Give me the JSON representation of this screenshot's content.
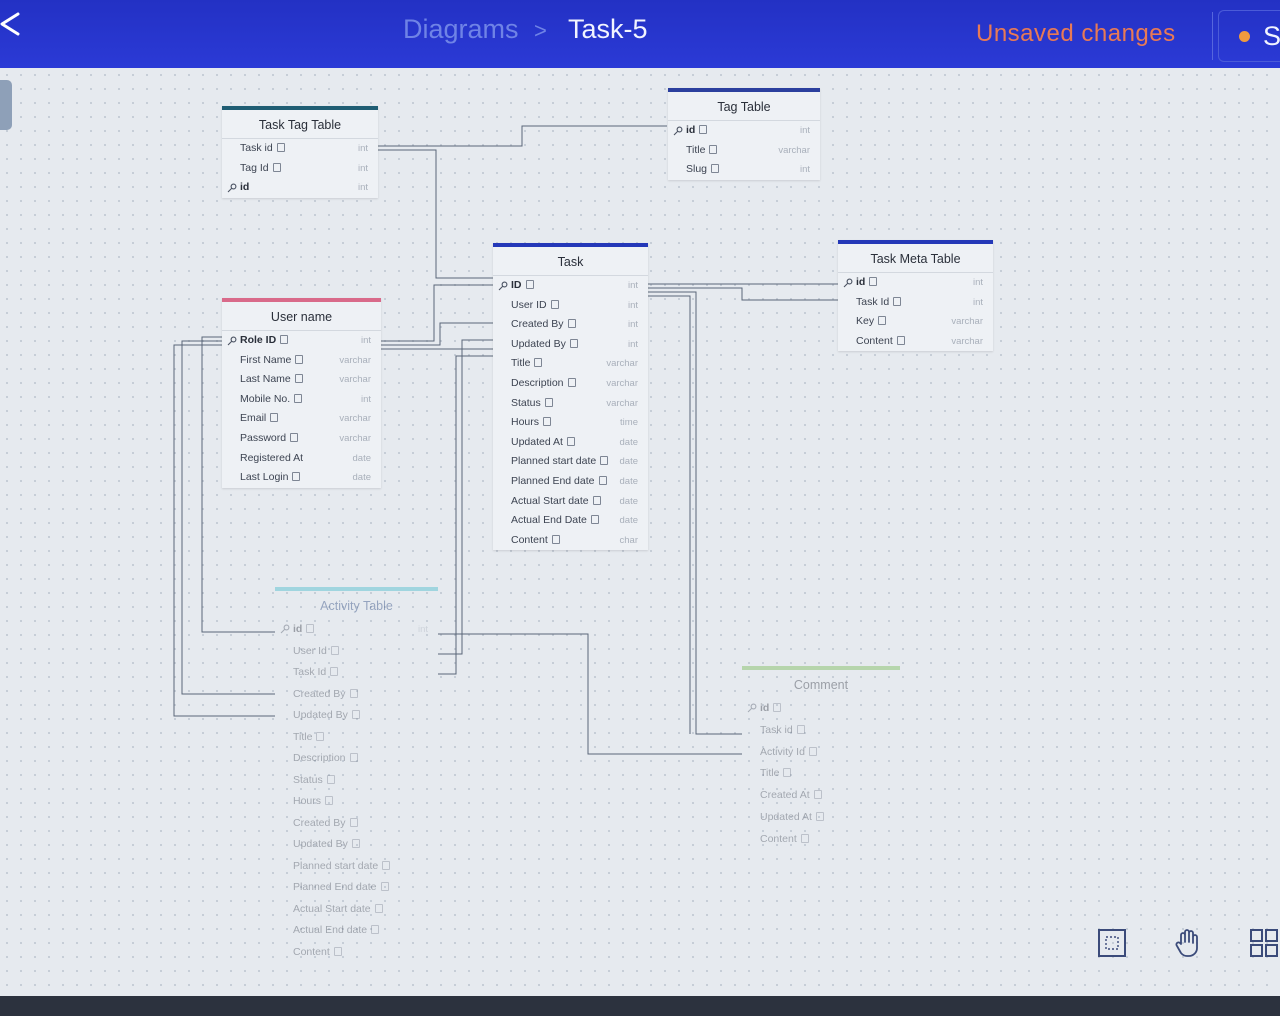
{
  "header": {
    "breadcrumb_root": "Diagrams",
    "breadcrumb_separator": ">",
    "breadcrumb_current": "Task-5",
    "status": "Unsaved changes",
    "save_label_partial": "S"
  },
  "colors": {
    "header_bg": "#2b3ad6",
    "status_text": "#e87a55",
    "accent_dot": "#f09a3e"
  },
  "tables": {
    "task_tag": {
      "title": "Task Tag Table",
      "bar_color": "#1f5d73",
      "rows": [
        {
          "name": "Task id",
          "type": "int"
        },
        {
          "name": "Tag Id",
          "type": "int"
        },
        {
          "name": "id",
          "type": "int"
        }
      ]
    },
    "tag": {
      "title": "Tag Table",
      "bar_color": "#2b3f9e",
      "rows": [
        {
          "name": "id",
          "type": "int"
        },
        {
          "name": "Title",
          "type": "varchar"
        },
        {
          "name": "Slug",
          "type": "int"
        }
      ]
    },
    "task": {
      "title": "Task",
      "bar_color": "#2438b8",
      "rows": [
        {
          "name": "ID",
          "type": "int"
        },
        {
          "name": "User ID",
          "type": "int"
        },
        {
          "name": "Created By",
          "type": "int"
        },
        {
          "name": "Updated By",
          "type": "int"
        },
        {
          "name": "Title",
          "type": "varchar"
        },
        {
          "name": "Description",
          "type": "varchar"
        },
        {
          "name": "Status",
          "type": "varchar"
        },
        {
          "name": "Hours",
          "type": "time"
        },
        {
          "name": "Updated At",
          "type": "date"
        },
        {
          "name": "Planned start date",
          "type": "date"
        },
        {
          "name": "Planned End date",
          "type": "date"
        },
        {
          "name": "Actual Start date",
          "type": "date"
        },
        {
          "name": "Actual End Date",
          "type": "date"
        },
        {
          "name": "Content",
          "type": "char"
        }
      ]
    },
    "task_meta": {
      "title": "Task Meta Table",
      "bar_color": "#2438b8",
      "rows": [
        {
          "name": "id",
          "type": "int"
        },
        {
          "name": "Task Id",
          "type": "int"
        },
        {
          "name": "Key",
          "type": "varchar"
        },
        {
          "name": "Content",
          "type": "varchar"
        }
      ]
    },
    "user": {
      "title": "User name",
      "bar_color": "#d96a8a",
      "rows": [
        {
          "name": "Role ID",
          "type": "int"
        },
        {
          "name": "First Name",
          "type": "varchar"
        },
        {
          "name": "Last Name",
          "type": "varchar"
        },
        {
          "name": "Mobile No.",
          "type": "int"
        },
        {
          "name": "Email",
          "type": "varchar"
        },
        {
          "name": "Password",
          "type": "varchar"
        },
        {
          "name": "Registered At",
          "type": "date"
        },
        {
          "name": "Last Login",
          "type": "date"
        }
      ]
    },
    "activity": {
      "title": "Activity Table",
      "bar_color": "#3ab6c8",
      "rows": [
        {
          "name": "id",
          "type": "int"
        },
        {
          "name": "User Id",
          "type": ""
        },
        {
          "name": "Task Id",
          "type": ""
        },
        {
          "name": "Created By",
          "type": ""
        },
        {
          "name": "Updated By",
          "type": ""
        },
        {
          "name": "Title",
          "type": ""
        },
        {
          "name": "Description",
          "type": ""
        },
        {
          "name": "Status",
          "type": ""
        },
        {
          "name": "Hours",
          "type": ""
        },
        {
          "name": "Created By",
          "type": ""
        },
        {
          "name": "Updated By",
          "type": ""
        },
        {
          "name": "Planned start date",
          "type": ""
        },
        {
          "name": "Planned End date",
          "type": ""
        },
        {
          "name": "Actual Start date",
          "type": ""
        },
        {
          "name": "Actual End date",
          "type": ""
        },
        {
          "name": "Content",
          "type": ""
        }
      ]
    },
    "comment": {
      "title": "Comment",
      "bar_color": "#6fb84a",
      "rows": [
        {
          "name": "id",
          "type": ""
        },
        {
          "name": "Task id",
          "type": ""
        },
        {
          "name": "Activity Id",
          "type": ""
        },
        {
          "name": "Title",
          "type": ""
        },
        {
          "name": "Created At",
          "type": ""
        },
        {
          "name": "Updated At",
          "type": ""
        },
        {
          "name": "Content",
          "type": ""
        }
      ]
    }
  },
  "toolbar": {
    "tools": [
      "fit-view-icon",
      "hand-pan-icon",
      "grid-layout-icon"
    ]
  }
}
